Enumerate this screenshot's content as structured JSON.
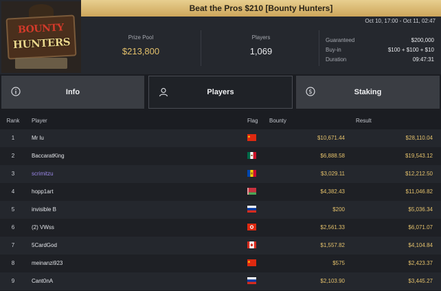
{
  "logo": {
    "line1": "BOUNTY",
    "line2": "HUNTERS"
  },
  "title": "Beat the Pros $210 [Bounty Hunters]",
  "date_range": "Oct 10, 17:00 - Oct 11, 02:47",
  "prize_pool": {
    "label": "Prize Pool",
    "value": "$213,800"
  },
  "players_stat": {
    "label": "Players",
    "value": "1,069"
  },
  "details": [
    {
      "key": "Guaranteed",
      "value": "$200,000"
    },
    {
      "key": "Buy-in",
      "value": "$100 + $100 + $10"
    },
    {
      "key": "Duration",
      "value": "09:47:31"
    }
  ],
  "tabs": {
    "info": {
      "label": "Info",
      "icon": "info-circle-icon"
    },
    "players": {
      "label": "Players",
      "icon": "user-icon",
      "active": true
    },
    "staking": {
      "label": "Staking",
      "icon": "dollar-circle-icon"
    }
  },
  "table": {
    "headers": {
      "rank": "Rank",
      "player": "Player",
      "flag": "Flag",
      "bounty": "Bounty",
      "result": "Result"
    },
    "rows": [
      {
        "rank": "1",
        "player": "Mr lu",
        "flag": "china",
        "bounty": "$10,671.44",
        "result": "$28,110.04"
      },
      {
        "rank": "2",
        "player": "BaccaratKing",
        "flag": "mexico",
        "bounty": "$6,888.58",
        "result": "$19,543.12"
      },
      {
        "rank": "3",
        "player": "scrimitzu",
        "flag": "moldova",
        "bounty": "$3,029.11",
        "result": "$12,212.50",
        "highlight": true
      },
      {
        "rank": "4",
        "player": "hopp1art",
        "flag": "belarus",
        "bounty": "$4,382.43",
        "result": "$11,046.82"
      },
      {
        "rank": "5",
        "player": "invisible B",
        "flag": "russia",
        "bounty": "$200",
        "result": "$5,036.34"
      },
      {
        "rank": "6",
        "player": "(2) VWss",
        "flag": "hong-kong",
        "bounty": "$2,561.33",
        "result": "$6,071.07"
      },
      {
        "rank": "7",
        "player": "5CardGod",
        "flag": "canada",
        "bounty": "$1,557.82",
        "result": "$4,104.84"
      },
      {
        "rank": "8",
        "player": "meinanzi923",
        "flag": "china",
        "bounty": "$575",
        "result": "$2,423.37"
      },
      {
        "rank": "9",
        "player": "Cant0nA",
        "flag": "russia",
        "bounty": "$2,103.90",
        "result": "$3,445.27"
      }
    ]
  },
  "colors": {
    "gold": "#e3c06b",
    "link": "#9b87e8",
    "title_bar": "#d9b771"
  }
}
